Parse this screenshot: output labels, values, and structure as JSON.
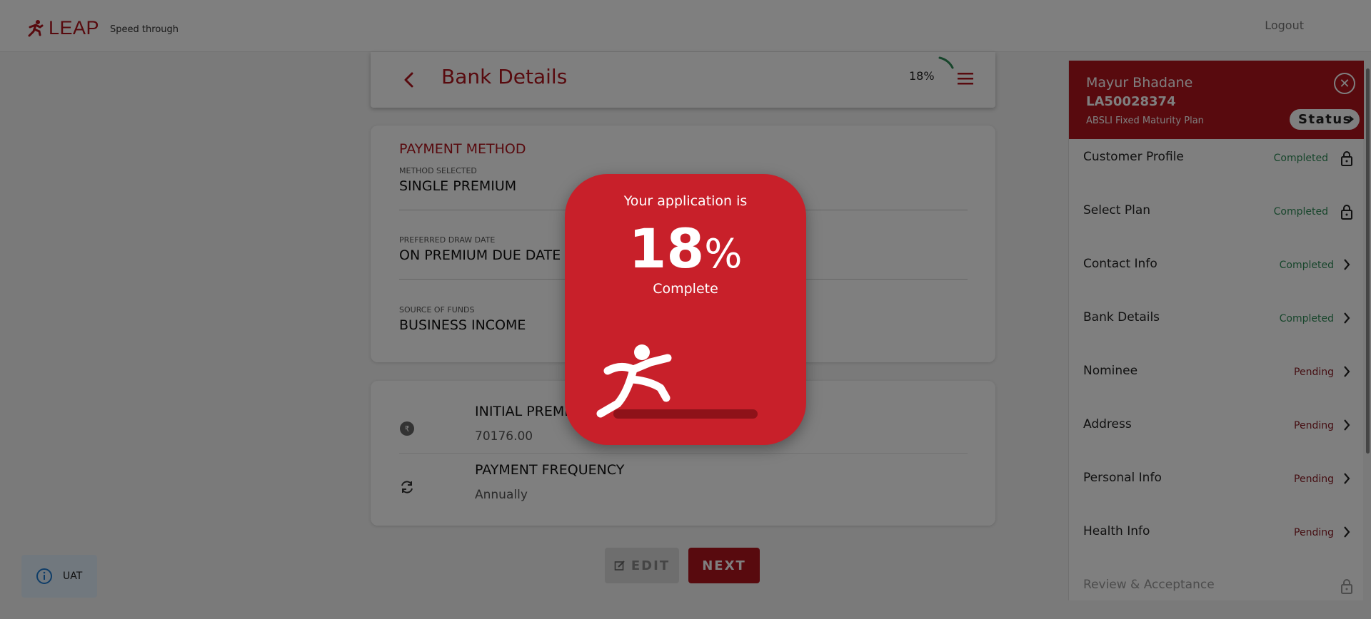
{
  "header": {
    "brand": "LEAP",
    "tagline": "Speed through",
    "logout_label": "Logout"
  },
  "page": {
    "title": "Bank Details",
    "progress_text": "18%",
    "progress_value": 0.18
  },
  "payment": {
    "section_title": "PAYMENT METHOD",
    "fields": [
      {
        "label": "METHOD SELECTED",
        "value": "SINGLE PREMIUM"
      },
      {
        "label": "PREFERRED DRAW DATE",
        "value": "ON PREMIUM DUE DATE"
      },
      {
        "label": "SOURCE OF FUNDS",
        "value": "BUSINESS INCOME"
      }
    ]
  },
  "premium": {
    "rows": [
      {
        "title": "INITIAL PREMIUM",
        "value": "70176.00",
        "icon": "rupee-icon"
      },
      {
        "title": "PAYMENT FREQUENCY",
        "value": "Annually",
        "icon": "refresh-icon"
      }
    ]
  },
  "buttons": {
    "edit_label": "EDIT",
    "next_label": "NEXT"
  },
  "sidebar": {
    "customer_name": "Mayur Bhadane",
    "policy_id": "LA50028374",
    "plan_name": "ABSLI Fixed Maturity Plan",
    "status_label": "Status",
    "steps": [
      {
        "name": "Customer Profile",
        "state": "Completed",
        "icon": "lock-icon"
      },
      {
        "name": "Select Plan",
        "state": "Completed",
        "icon": "lock-icon"
      },
      {
        "name": "Contact Info",
        "state": "Completed",
        "icon": "chevron-right-icon"
      },
      {
        "name": "Bank Details",
        "state": "Completed",
        "icon": "chevron-right-icon"
      },
      {
        "name": "Nominee",
        "state": "Pending",
        "icon": "chevron-right-icon"
      },
      {
        "name": "Address",
        "state": "Pending",
        "icon": "chevron-right-icon"
      },
      {
        "name": "Personal Info",
        "state": "Pending",
        "icon": "chevron-right-icon"
      },
      {
        "name": "Health Info",
        "state": "Pending",
        "icon": "chevron-right-icon"
      },
      {
        "name": "Review & Acceptance",
        "state": "",
        "icon": "lock-icon"
      }
    ]
  },
  "env_badge": {
    "label": "UAT",
    "icon": "info-icon"
  },
  "modal": {
    "line1": "Your application is",
    "percent_number": "18",
    "percent_sign": "%",
    "line2": "Complete"
  },
  "colors": {
    "brand_red": "#b0141d",
    "modal_red": "#c8202a",
    "completed_green": "#2e8b57",
    "pending_red": "#8a1c24"
  }
}
